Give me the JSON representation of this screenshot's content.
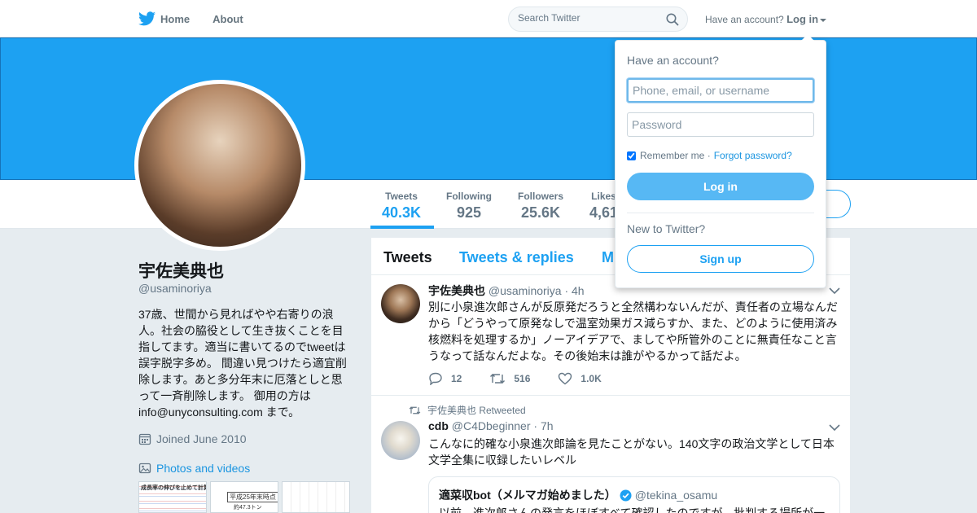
{
  "nav": {
    "home_label": "Home",
    "about_label": "About",
    "search_placeholder": "Search Twitter",
    "account_prompt": "Have an account?",
    "login_label": "Log in"
  },
  "profile": {
    "name": "宇佐美典也",
    "handle": "@usaminoriya",
    "bio": "37歳、世間から見ればやや右寄りの浪人。社会の脇役として生き抜くことを目指してます。適当に書いてるのでtweetは誤字脱字多め。 間違い見つけたら適宜削除します。あと多分年末に厄落としと思って一斉削除します。 御用の方は info@unyconsulting.com まで。",
    "joined": "Joined June 2010",
    "photos_label": "Photos and videos",
    "thumbs": [
      "成長率の伸びを止めて計算している主要国指標",
      "平成25年末時点",
      "約47.3トン"
    ]
  },
  "stats": [
    {
      "label": "Tweets",
      "value": "40.3K"
    },
    {
      "label": "Following",
      "value": "925"
    },
    {
      "label": "Followers",
      "value": "25.6K"
    },
    {
      "label": "Likes",
      "value": "4,61"
    }
  ],
  "timeline": {
    "tabs": [
      "Tweets",
      "Tweets & replies",
      "M"
    ],
    "tweets": [
      {
        "name": "宇佐美典也",
        "handle": "@usaminoriya",
        "time": "· 4h",
        "text": "別に小泉進次郎さんが反原発だろうと全然構わないんだが、責任者の立場なんだから「どうやって原発なしで温室効果ガス減らすか、また、どのように使用済み核燃料を処理するか」ノーアイデアで、ましてや所管外のことに無責任なこと言うなって話なんだよな。その後始末は誰がやるかって話だよ。",
        "replies": "12",
        "retweets": "516",
        "likes": "1.0K"
      },
      {
        "retweeted_by": "宇佐美典也 Retweeted",
        "name": "cdb",
        "handle": "@C4Dbeginner",
        "time": "· 7h",
        "text": "こんなに的確な小泉進次郎論を見たことがない。140文字の政治文学として日本文学全集に収録したいレベル",
        "quote": {
          "name": "適菜収bot（メルマガ始めました）",
          "handle": "@tekina_osamu",
          "text": "以前、進次郎さんの発言をほぼすべて確認したのですが、批判する場所が一"
        }
      }
    ]
  },
  "login": {
    "title": "Have an account?",
    "username_placeholder": "Phone, email, or username",
    "password_placeholder": "Password",
    "remember_label": "Remember me",
    "forgot_label": "Forgot password?",
    "login_button": "Log in",
    "new_prompt": "New to Twitter?",
    "signup_button": "Sign up"
  },
  "colors": {
    "brand": "#1da1f2",
    "link": "#1b95e0",
    "banner": "#1da1f2"
  }
}
